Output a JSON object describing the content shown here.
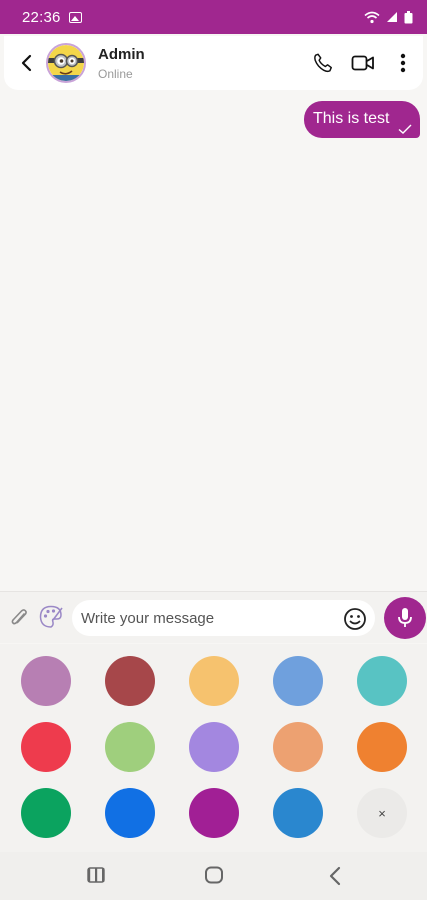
{
  "status_bar": {
    "time": "22:36"
  },
  "header": {
    "contact_name": "Admin",
    "contact_status": "Online"
  },
  "messages": [
    {
      "text": "This is test",
      "direction": "outgoing",
      "status": "sent"
    }
  ],
  "composer": {
    "placeholder": "Write your message"
  },
  "color_palette": {
    "colors": [
      "#b77fb3",
      "#a6474a",
      "#f6c26e",
      "#6fa0dd",
      "#58c3c3",
      "#ee3b4d",
      "#9fcf7d",
      "#a387e0",
      "#eda171",
      "#ef8130",
      "#0ba35f",
      "#1170e4",
      "#a11f95",
      "#2a87cf"
    ],
    "close_label": "×"
  },
  "theme": {
    "accent": "#a0278f"
  }
}
